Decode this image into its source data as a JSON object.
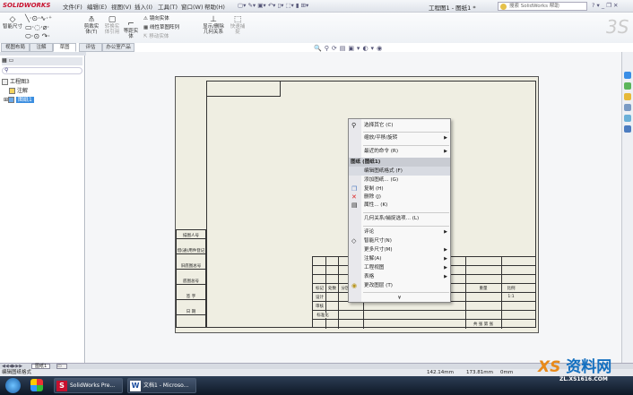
{
  "app": {
    "logo": "SOLIDWORKS",
    "title": "工程图1 - 图纸1 *",
    "menus": [
      "文件(F)",
      "编辑(E)",
      "视图(V)",
      "插入(I)",
      "工具(T)",
      "窗口(W)",
      "帮助(H)"
    ],
    "search_placeholder": "搜索 SolidWorks 帮助"
  },
  "ribbon": {
    "smart_dim": "智能尺寸",
    "trim": "剪裁实体(T)",
    "convert": "转换实体引用",
    "offset": "等距实体",
    "mirror": "镜向实体",
    "linear_pattern": "线性草图阵列",
    "move": "移动实体",
    "display_relations": "显示/删除几何关系",
    "quick_snap": "快速捕捉"
  },
  "tabs": [
    "视图布局",
    "注解",
    "草图",
    "评估",
    "办公室产品"
  ],
  "active_tab": "草图",
  "tree": {
    "root": "工程图3",
    "items": [
      "注解",
      "图纸1"
    ]
  },
  "title_block": {
    "left_labels": [
      "描图人号",
      "借(通)用件登记",
      "旧底图总号",
      "底图总号",
      "签 字",
      "日 期"
    ],
    "labels": [
      "标记",
      "处数",
      "分区",
      "设计",
      "审核",
      "工艺",
      "标准化",
      "批准",
      "比例",
      "共 张 第 张",
      "重量",
      "1:1"
    ]
  },
  "context_menu": {
    "items": [
      {
        "label": "选择其它 (C)",
        "icon": "select-other-icon"
      },
      {
        "label": "缩放/平移/旋转",
        "submenu": true
      },
      {
        "label": "最近的命令 (R)",
        "submenu": true
      },
      {
        "label": "图纸 (图纸1)",
        "header": true
      },
      {
        "label": "编辑图纸格式 (F)",
        "highlighted": true
      },
      {
        "label": "添加图纸... (G)"
      },
      {
        "label": "复制 (H)",
        "icon": "copy-icon"
      },
      {
        "label": "删除 (J)",
        "icon": "delete-icon"
      },
      {
        "label": "属性... (K)",
        "icon": "properties-icon"
      },
      {
        "label": "几何关系/捕捉选项... (L)"
      },
      {
        "label": "评论",
        "submenu": true
      },
      {
        "label": "智能尺寸(N)",
        "icon": "smart-dimension-icon"
      },
      {
        "label": "更多尺寸(M)",
        "submenu": true
      },
      {
        "label": "注解(A)",
        "submenu": true
      },
      {
        "label": "工程视图",
        "submenu": true
      },
      {
        "label": "表格",
        "submenu": true
      },
      {
        "label": "更改图层 (T)",
        "icon": "layer-icon"
      },
      {
        "label": "¥",
        "more": true
      }
    ]
  },
  "sheet_tab": "图纸1",
  "status": {
    "text": "编辑图纸格式",
    "x": "142.14mm",
    "y": "173.81mm",
    "z": "0mm"
  },
  "taskbar": {
    "items": [
      "SolidWorks Pre...",
      "文档1 - Microso..."
    ]
  },
  "watermark": {
    "text": "资料网",
    "url": "ZL.XS1616.COM"
  }
}
